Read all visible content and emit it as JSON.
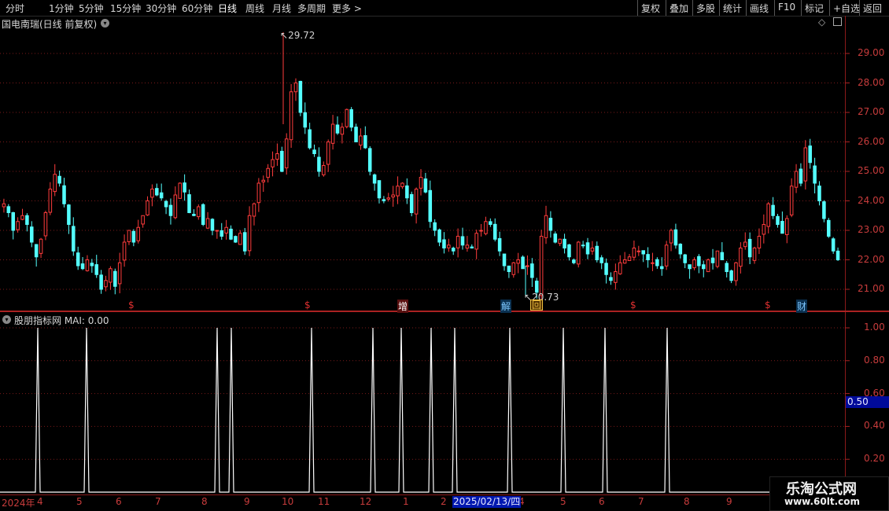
{
  "toolbar": {
    "periods": [
      "分时",
      "1分钟",
      "5分钟",
      "15分钟",
      "30分钟",
      "60分钟",
      "日线",
      "周线",
      "月线",
      "多周期",
      "更多 >"
    ],
    "active_period": "日线",
    "right": [
      "复权",
      "叠加",
      "多股",
      "统计",
      "画线",
      "F10",
      "标记",
      "+自选",
      "返回"
    ]
  },
  "main_chart": {
    "title": "国电南瑞(日线 前复权)",
    "y_ticks": [
      "29.00",
      "28.00",
      "27.00",
      "26.00",
      "25.00",
      "24.00",
      "23.00",
      "22.00",
      "21.00"
    ],
    "high_label": "29.72",
    "low_label": "20.73",
    "events": [
      {
        "text": "$",
        "color": "#e03030"
      },
      {
        "text": "$",
        "color": "#e03030"
      },
      {
        "text": "增",
        "color": "#ffffff"
      },
      {
        "text": "解",
        "color": "#7ec8ff"
      },
      {
        "text": "回",
        "color": "#f0c040"
      },
      {
        "text": "$",
        "color": "#e03030"
      },
      {
        "text": "$",
        "color": "#e03030"
      },
      {
        "text": "财",
        "color": "#7ec8ff"
      }
    ]
  },
  "indicator": {
    "title": "股朋指标网 MAI: 0.00",
    "y_ticks": [
      "1.00",
      "0.80",
      "0.60",
      "0.40",
      "0.20"
    ],
    "current_value": "0.50"
  },
  "x_axis": {
    "labels": [
      "2024年",
      "4",
      "5",
      "6",
      "7",
      "8",
      "9",
      "10",
      "11",
      "12",
      "1",
      "2",
      "4",
      "5",
      "6",
      "7",
      "8",
      "9"
    ],
    "cursor_date": "2025/02/13/四"
  },
  "watermark": {
    "line1": "乐淘公式网",
    "line2": "www.60lt.com"
  },
  "chart_data": [
    {
      "type": "candlestick",
      "title": "国电南瑞(日线 前复权)",
      "ylim": [
        20.6,
        29.9
      ],
      "annotations": [
        {
          "label": "29.72",
          "value": 29.72
        },
        {
          "label": "20.73",
          "value": 20.73
        }
      ],
      "close_path": [
        23.9,
        23.6,
        23.0,
        23.3,
        23.5,
        23.2,
        22.6,
        22.1,
        22.7,
        23.6,
        24.4,
        24.9,
        24.6,
        23.9,
        23.2,
        22.3,
        21.8,
        21.7,
        22.0,
        21.8,
        21.5,
        21.0,
        21.3,
        21.7,
        21.1,
        21.9,
        22.6,
        23.0,
        22.6,
        23.1,
        23.5,
        24.0,
        24.4,
        24.2,
        24.1,
        23.8,
        23.5,
        24.2,
        24.6,
        24.3,
        23.6,
        23.5,
        23.8,
        23.2,
        23.4,
        23.0,
        23.0,
        22.8,
        23.1,
        22.7,
        22.6,
        22.9,
        22.3,
        23.5,
        23.9,
        24.6,
        24.7,
        25.1,
        25.4,
        25.6,
        25.0,
        26.1,
        27.7,
        28.0,
        27.0,
        26.5,
        25.8,
        25.6,
        25.0,
        25.2,
        26.0,
        26.6,
        26.3,
        26.5,
        27.1,
        26.5,
        26.0,
        26.2,
        25.8,
        25.0,
        24.6,
        24.1,
        24.0,
        24.1,
        24.2,
        24.5,
        24.6,
        24.1,
        23.6,
        24.4,
        24.8,
        24.3,
        23.3,
        23.0,
        22.6,
        22.4,
        22.5,
        22.3,
        22.8,
        22.5,
        22.5,
        22.4,
        22.9,
        23.0,
        23.3,
        23.2,
        22.7,
        22.3,
        21.8,
        21.6,
        21.9,
        22.0,
        21.7,
        21.8,
        21.4,
        20.9,
        22.8,
        23.5,
        23.0,
        22.6,
        22.7,
        22.4,
        22.1,
        21.9,
        22.6,
        22.5,
        22.2,
        22.4,
        22.0,
        21.9,
        21.5,
        21.3,
        21.6,
        21.9,
        22.0,
        22.1,
        22.4,
        22.3,
        22.2,
        22.0,
        21.9,
        21.8,
        21.7,
        22.5,
        23.0,
        22.5,
        22.2,
        21.9,
        21.7,
        22.0,
        21.8,
        21.7,
        22.0,
        21.9,
        22.3,
        22.0,
        21.6,
        21.3,
        21.9,
        22.4,
        22.6,
        22.1,
        22.4,
        22.8,
        23.2,
        23.9,
        23.5,
        23.2,
        22.9,
        23.4,
        24.5,
        25.0,
        24.6,
        25.8,
        25.3,
        24.6,
        24.0,
        23.4,
        22.8,
        22.3,
        22.0
      ]
    },
    {
      "type": "line",
      "title": "股朋指标网 MAI",
      "series": [
        {
          "name": "MAI",
          "values": [
            0.0
          ]
        }
      ],
      "ylim": [
        0,
        1.05
      ],
      "spike_value": 1.0,
      "baseline_value": 0.0
    }
  ]
}
